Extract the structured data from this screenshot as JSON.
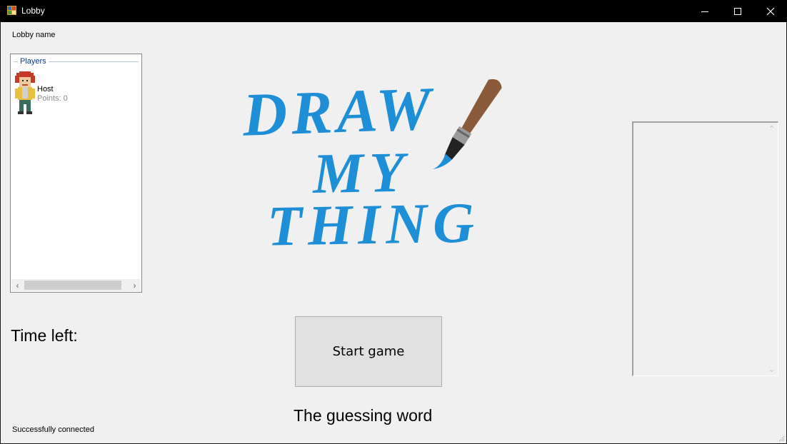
{
  "window": {
    "title": "Lobby",
    "controls": {
      "minimize": "minimize-icon",
      "maximize": "maximize-icon",
      "close": "close-icon"
    }
  },
  "lobby": {
    "name_label": "Lobby name"
  },
  "players": {
    "group_title": "Players",
    "list": [
      {
        "name": "Host",
        "points": "Points: 0",
        "avatar": "pixel-character-icon"
      }
    ]
  },
  "logo": {
    "lines": [
      "DRAW",
      "MY",
      "THING"
    ],
    "color": "#1e8fd6",
    "icon": "paintbrush-icon"
  },
  "timer": {
    "label": "Time left:"
  },
  "actions": {
    "start_label": "Start game"
  },
  "game": {
    "guess_word_label": "The guessing word"
  },
  "status": {
    "text": "Successfully connected"
  },
  "colors": {
    "background": "#f0f0f0",
    "titlebar": "#000000",
    "group_title": "#0e3a8c",
    "logo_blue": "#1e8fd6"
  }
}
